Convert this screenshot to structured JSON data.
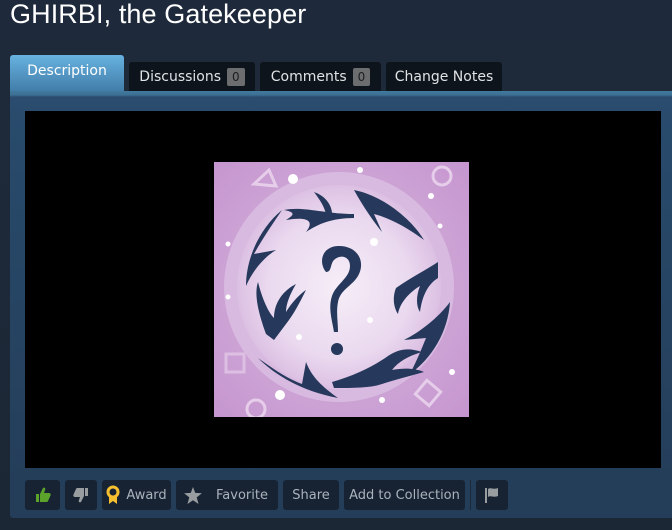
{
  "header": {
    "title": "GHIRBI, the Gatekeeper"
  },
  "tabs": [
    {
      "label": "Description",
      "active": true
    },
    {
      "label": "Discussions",
      "count": "0",
      "active": false
    },
    {
      "label": "Comments",
      "count": "0",
      "active": false
    },
    {
      "label": "Change Notes",
      "active": false
    }
  ],
  "media": {
    "preview_alt": "Question mark emblem with antler shapes in a circle on pink background",
    "colors": {
      "background": "#c99fd2",
      "circle": "#e9d8ee",
      "emblem": "#26385c"
    }
  },
  "actions": {
    "thumbs_up_icon": "thumbs-up-icon",
    "thumbs_down_icon": "thumbs-down-icon",
    "award_label": "Award",
    "favorite_label": "Favorite",
    "share_label": "Share",
    "add_to_collection_label": "Add to Collection",
    "flag_icon": "flag-icon"
  },
  "colors": {
    "thumbs_up": "#5ba32b",
    "award": "#f5c02f",
    "active_tab": "#5fa6d6"
  }
}
